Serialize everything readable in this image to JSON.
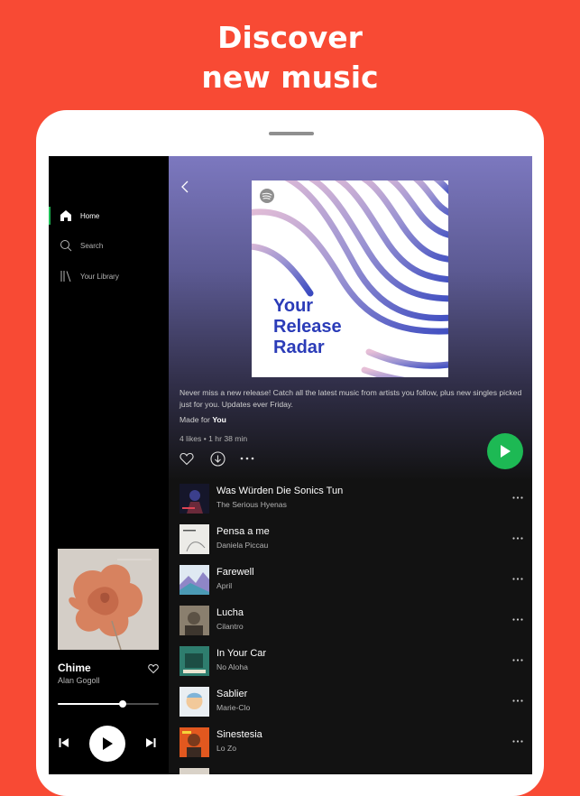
{
  "headline": {
    "line1": "Discover",
    "line2": "new music"
  },
  "sidebar": {
    "items": [
      {
        "label": "Home",
        "icon": "home-icon",
        "active": true
      },
      {
        "label": "Search",
        "icon": "search-icon",
        "active": false
      },
      {
        "label": "Your Library",
        "icon": "library-icon",
        "active": false
      }
    ]
  },
  "now_playing": {
    "title": "Chime",
    "artist": "Alan Gogoll",
    "progress": 0.64,
    "art_caption": "ALAN GOGOLL | CHIME"
  },
  "playlist": {
    "cover_title_lines": [
      "Your",
      "Release",
      "Radar"
    ],
    "description": "Never miss a new release! Catch all the latest music from artists you follow, plus new singles picked just for you. Updates ever Friday.",
    "made_for_prefix": "Made for",
    "made_for_user": "You",
    "stats": "4 likes • 1 hr 38 min"
  },
  "tracks": [
    {
      "title": "Was Würden Die Sonics Tun",
      "artist": "The Serious Hyenas"
    },
    {
      "title": "Pensa a me",
      "artist": "Daniela Piccau"
    },
    {
      "title": "Farewell",
      "artist": "April"
    },
    {
      "title": "Lucha",
      "artist": "Cilantro"
    },
    {
      "title": "In Your Car",
      "artist": "No Aloha"
    },
    {
      "title": "Sablier",
      "artist": "Marie-Clo"
    },
    {
      "title": "Sinestesia",
      "artist": "Lo Zo"
    }
  ],
  "colors": {
    "background": "#f84a34",
    "accent": "#1db954",
    "cover_text": "#2b3cb8"
  }
}
